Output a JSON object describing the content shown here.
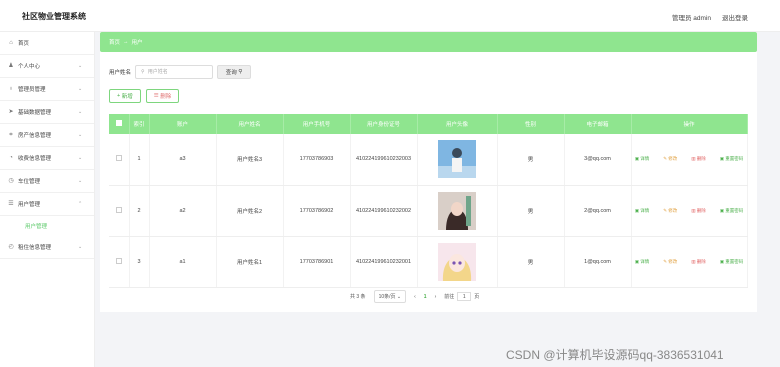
{
  "header": {
    "title": "社区物业管理系统",
    "admin": "管理员 admin",
    "logout": "退出登录"
  },
  "sidebar": {
    "items": [
      {
        "label": "首页",
        "icon": "home-icon",
        "glyph": "⌂"
      },
      {
        "label": "个人中心",
        "icon": "user-icon",
        "glyph": "♟"
      },
      {
        "label": "管理员管理",
        "icon": "mic-icon",
        "glyph": "♁"
      },
      {
        "label": "基础数据管理",
        "icon": "send-icon",
        "glyph": "➤"
      },
      {
        "label": "房产信息管理",
        "icon": "crop-icon",
        "glyph": "⌗"
      },
      {
        "label": "收费信息管理",
        "icon": "gauge-icon",
        "glyph": "◔"
      },
      {
        "label": "车位管理",
        "icon": "clock-icon",
        "glyph": "◷"
      },
      {
        "label": "用户管理",
        "icon": "filter-icon",
        "glyph": "☰"
      },
      {
        "label": "租住信息管理",
        "icon": "history-icon",
        "glyph": "◴"
      }
    ],
    "sub_item": "用户管理"
  },
  "breadcrumb": {
    "home": "首页",
    "sep": "→",
    "current": "用户"
  },
  "search": {
    "label": "用户姓名",
    "placeholder": "用户姓名",
    "button": "查询"
  },
  "actions": {
    "add": "新增",
    "delete": "删除"
  },
  "table": {
    "headers": [
      "索引",
      "账户",
      "用户姓名",
      "用户手机号",
      "用户身份证号",
      "用户头像",
      "性别",
      "电子邮箱",
      "操作"
    ],
    "rows": [
      {
        "index": "1",
        "account": "a3",
        "name": "用户姓名3",
        "phone": "17703786903",
        "id_card": "410224199610232003",
        "gender": "男",
        "email": "3@qq.com"
      },
      {
        "index": "2",
        "account": "a2",
        "name": "用户姓名2",
        "phone": "17703786902",
        "id_card": "410224199610232002",
        "gender": "男",
        "email": "2@qq.com"
      },
      {
        "index": "3",
        "account": "a1",
        "name": "用户姓名1",
        "phone": "17703786901",
        "id_card": "410224199610232001",
        "gender": "男",
        "email": "1@qq.com"
      }
    ],
    "ops": {
      "detail": "详情",
      "edit": "修改",
      "delete": "删除",
      "reset": "重置密码"
    }
  },
  "pagination": {
    "total": "共 3 条",
    "page_size": "10条/页",
    "prev": "‹",
    "current": "1",
    "next": "›",
    "goto_prefix": "前往",
    "goto_value": "1",
    "goto_suffix": "页"
  },
  "watermark": "CSDN @计算机毕设源码qq-3836531041",
  "colors": {
    "accent": "#8fe58f",
    "accent_dark": "#4cb04c"
  }
}
